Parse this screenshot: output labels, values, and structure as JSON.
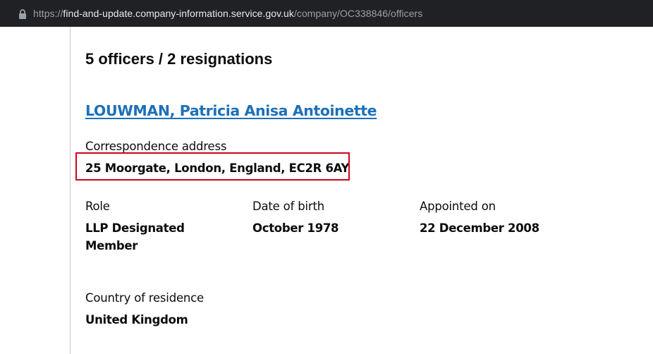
{
  "browser": {
    "url_scheme": "https://",
    "url_host": "find-and-update.company-information.service.gov.uk",
    "url_path": "/company/OC338846/officers",
    "lock_icon": "lock-icon"
  },
  "page": {
    "heading": "5 officers / 2 resignations",
    "officer": {
      "name": "LOUWMAN, Patricia Anisa Antoinette",
      "correspondence_label": "Correspondence address",
      "correspondence_value": "25 Moorgate, London, England, EC2R 6AY",
      "role_label": "Role",
      "role_value": "LLP Designated Member",
      "dob_label": "Date of birth",
      "dob_value": "October 1978",
      "appointed_label": "Appointed on",
      "appointed_value": "22 December 2008",
      "residence_label": "Country of residence",
      "residence_value": "United Kingdom"
    }
  },
  "colors": {
    "link": "#1d70b8",
    "highlight": "#d0021b",
    "text": "#0b0c0c",
    "address_bar": "#202124"
  }
}
